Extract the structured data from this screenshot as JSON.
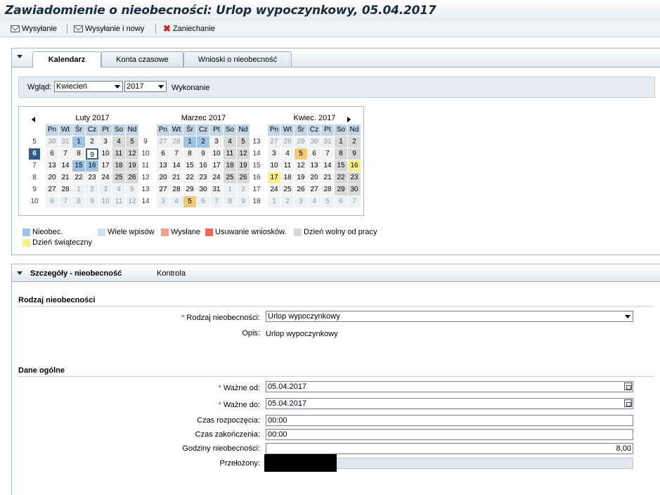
{
  "window": {
    "title": "Zawiadomienie o nieobecności: Urlop wypoczynkowy, 05.04.2017"
  },
  "toolbar": {
    "send_label": "Wysyłanie",
    "send_new_label": "Wysyłanie i nowy",
    "cancel_label": "Zaniechanie"
  },
  "tabs": [
    {
      "label": "Kalendarz",
      "active": true
    },
    {
      "label": "Konta czasowe",
      "active": false
    },
    {
      "label": "Wnioski o nieobecność",
      "active": false
    }
  ],
  "view": {
    "label": "Wgląd:",
    "month": "Kwiecień",
    "year": "2017",
    "execute_label": "Wykonanie"
  },
  "calendar": {
    "day_headers": [
      "Pn",
      "Wt",
      "Śr",
      "Cz",
      "Pt",
      "So",
      "Nd"
    ],
    "months": [
      {
        "title": "Luty 2017",
        "weeks": [
          "5",
          "6",
          "7",
          "8",
          "9",
          "10"
        ],
        "rows": [
          [
            "30",
            "31",
            "1",
            "2",
            "3",
            "4",
            "5"
          ],
          [
            "6",
            "7",
            "8",
            "9",
            "10",
            "11",
            "12"
          ],
          [
            "13",
            "14",
            "15",
            "16",
            "17",
            "18",
            "19"
          ],
          [
            "20",
            "21",
            "22",
            "23",
            "24",
            "25",
            "26"
          ],
          [
            "27",
            "28",
            "1",
            "2",
            "3",
            "4",
            "5"
          ],
          [
            "6",
            "7",
            "8",
            "9",
            "10",
            "11",
            "12"
          ]
        ],
        "states": [
          [
            "other",
            "other",
            "abs",
            "wkd",
            "wkd",
            "wkend",
            "wkend"
          ],
          [
            "wkd",
            "wkd",
            "wkd",
            "selected",
            "wkd",
            "wkend",
            "wkend"
          ],
          [
            "wkd",
            "wkd",
            "abs",
            "abs",
            "wkd",
            "wkend",
            "wkend"
          ],
          [
            "wkd",
            "wkd",
            "wkd",
            "wkd",
            "wkd",
            "wkend",
            "wkend"
          ],
          [
            "wkd",
            "wkd",
            "other",
            "other",
            "other",
            "other",
            "other"
          ],
          [
            "other",
            "other",
            "other",
            "other",
            "other",
            "other",
            "other"
          ]
        ]
      },
      {
        "title": "Marzec 2017",
        "weeks": [
          "9",
          "10",
          "11",
          "12",
          "13",
          "14"
        ],
        "rows": [
          [
            "27",
            "28",
            "1",
            "2",
            "3",
            "4",
            "5"
          ],
          [
            "6",
            "7",
            "8",
            "9",
            "10",
            "11",
            "12"
          ],
          [
            "13",
            "14",
            "15",
            "16",
            "17",
            "18",
            "19"
          ],
          [
            "20",
            "21",
            "22",
            "23",
            "24",
            "25",
            "26"
          ],
          [
            "27",
            "28",
            "29",
            "30",
            "31",
            "1",
            "2"
          ],
          [
            "3",
            "4",
            "5",
            "6",
            "7",
            "8",
            "9"
          ]
        ],
        "states": [
          [
            "other",
            "other",
            "abs",
            "abs",
            "wkd",
            "wkend",
            "wkend"
          ],
          [
            "wkd",
            "wkd",
            "wkd",
            "wkd",
            "wkd",
            "wkend",
            "wkend"
          ],
          [
            "wkd",
            "wkd",
            "wkd",
            "wkd",
            "wkd",
            "wkend",
            "wkend"
          ],
          [
            "wkd",
            "wkd",
            "wkd",
            "wkd",
            "wkd",
            "wkend",
            "wkend"
          ],
          [
            "wkd",
            "wkd",
            "wkd",
            "wkd",
            "wkd",
            "other",
            "other"
          ],
          [
            "other",
            "other",
            "pending",
            "other",
            "other",
            "other",
            "other"
          ]
        ]
      },
      {
        "title": "Kwiec. 2017",
        "weeks": [
          "13",
          "14",
          "15",
          "16",
          "17",
          "18"
        ],
        "rows": [
          [
            "27",
            "28",
            "29",
            "30",
            "31",
            "1",
            "2"
          ],
          [
            "3",
            "4",
            "5",
            "6",
            "7",
            "8",
            "9"
          ],
          [
            "10",
            "11",
            "12",
            "13",
            "14",
            "15",
            "16"
          ],
          [
            "17",
            "18",
            "19",
            "20",
            "21",
            "22",
            "23"
          ],
          [
            "24",
            "25",
            "26",
            "27",
            "28",
            "29",
            "30"
          ],
          [
            "1",
            "2",
            "3",
            "4",
            "5",
            "6",
            "7"
          ]
        ],
        "states": [
          [
            "other",
            "other",
            "other",
            "other",
            "other",
            "wkend",
            "wkend"
          ],
          [
            "wkd",
            "wkd",
            "pending",
            "wkd",
            "wkd",
            "wkend",
            "wkend"
          ],
          [
            "wkd",
            "wkd",
            "wkd",
            "wkd",
            "wkd",
            "wkend",
            "holiday"
          ],
          [
            "holiday",
            "wkd",
            "wkd",
            "wkd",
            "wkd",
            "wkend",
            "wkend"
          ],
          [
            "wkd",
            "wkd",
            "wkd",
            "wkd",
            "wkd",
            "wkend",
            "wkend"
          ],
          [
            "other",
            "other",
            "other",
            "other",
            "other",
            "other",
            "other"
          ]
        ]
      }
    ],
    "today_week_label": "6"
  },
  "legend": [
    {
      "label": "Nieobec.",
      "color": "#9dc2e4"
    },
    {
      "label": "Wiele wpisów",
      "color": "#cfe0f0"
    },
    {
      "label": "Wysłane",
      "color": "#f4a08a"
    },
    {
      "label": "Usuwanie wniosków.",
      "color": "#ee6a5a"
    },
    {
      "label": "Dzień wolny od pracy",
      "color": "#d8d8d8"
    },
    {
      "label": "Dzień świąteczny",
      "color": "#f8ef8f"
    }
  ],
  "details": {
    "header": "Szczegóły - nieobecność",
    "control_label": "Kontrola",
    "section1": "Rodzaj nieobecności",
    "type_label": "Rodzaj nieobecności:",
    "type_value": "Urlop wypoczynkowy",
    "desc_label": "Opis:",
    "desc_value": "Urlop wypoczynkowy",
    "section2": "Dane ogólne",
    "valid_from_label": "Ważne od:",
    "valid_from_value": "05.04.2017",
    "valid_to_label": "Ważne do:",
    "valid_to_value": "05.04.2017",
    "start_time_label": "Czas rozpoczęcia:",
    "start_time_value": "00:00",
    "end_time_label": "Czas zakończenia:",
    "end_time_value": "00:00",
    "hours_label": "Godziny nieobecności:",
    "hours_value": "8,00",
    "approver_label": "Przełożony:",
    "approver_value": ""
  }
}
